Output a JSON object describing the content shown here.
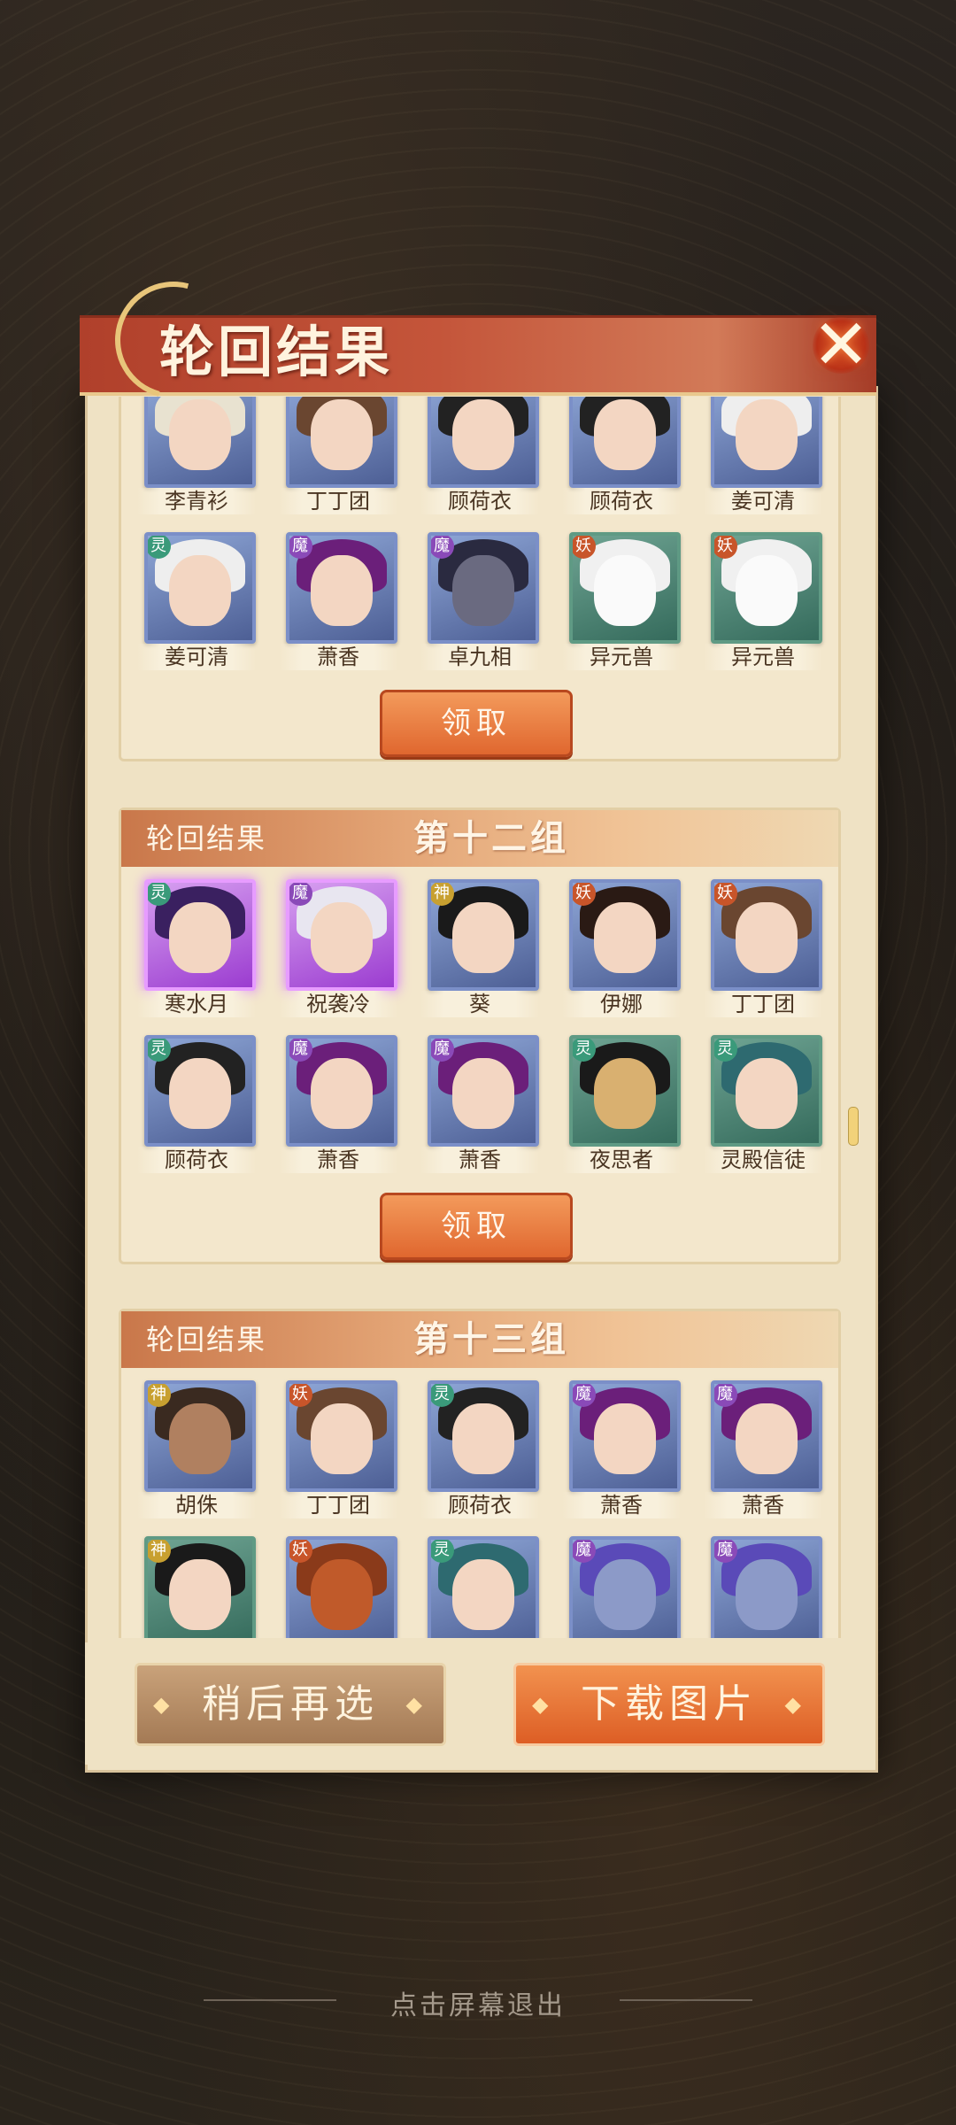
{
  "dialog": {
    "title": "轮回结果",
    "close_icon": "close-icon"
  },
  "colors": {
    "accent": "#e0672f",
    "title_bar": "#b0402b",
    "panel": "#efe2c4"
  },
  "group_prev": {
    "row1": [
      "李青衫",
      "丁丁团",
      "顾荷衣",
      "顾荷衣",
      "姜可清"
    ],
    "row2": [
      "姜可清",
      "萧香",
      "卓九相",
      "异元兽",
      "异元兽"
    ],
    "row2_badges": [
      "灵",
      "魔",
      "魔",
      "妖",
      "妖"
    ],
    "claim_label": "领取"
  },
  "group_12": {
    "header_left": "轮回结果",
    "header_title": "第十二组",
    "row1": [
      "寒水月",
      "祝袭冷",
      "葵",
      "伊娜",
      "丁丁团"
    ],
    "row1_badges": [
      "灵",
      "魔",
      "神",
      "妖",
      "妖"
    ],
    "row2": [
      "顾荷衣",
      "萧香",
      "萧香",
      "夜思者",
      "灵殿信徒"
    ],
    "row2_badges": [
      "灵",
      "魔",
      "魔",
      "灵",
      "灵"
    ],
    "claim_label": "领取"
  },
  "group_13": {
    "header_left": "轮回结果",
    "header_title": "第十三组",
    "row1": [
      "胡侏",
      "丁丁团",
      "顾荷衣",
      "萧香",
      "萧香"
    ],
    "row1_badges": [
      "神",
      "妖",
      "灵",
      "魔",
      "魔"
    ],
    "row2_badges": [
      "神",
      "妖",
      "灵",
      "魔",
      "魔"
    ]
  },
  "buttons": {
    "later": "稍后再选",
    "download": "下载图片"
  },
  "footer": {
    "exit_hint": "点击屏幕退出"
  }
}
